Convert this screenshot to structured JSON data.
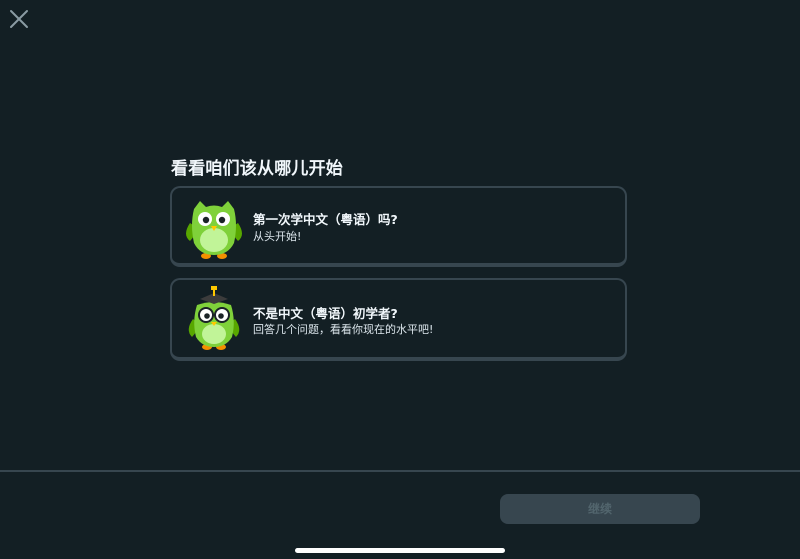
{
  "header": {
    "close_icon": "close-icon"
  },
  "main": {
    "title": "看看咱们该从哪儿开始",
    "options": [
      {
        "icon": "owl-mascot-icon",
        "title": "第一次学中文（粤语）吗?",
        "subtitle": "从头开始!"
      },
      {
        "icon": "owl-graduate-mascot-icon",
        "title": "不是中文（粤语）初学者?",
        "subtitle": "回答几个问题，看看你现在的水平吧!"
      }
    ]
  },
  "footer": {
    "continue_label": "继续",
    "continue_state": "disabled"
  },
  "colors": {
    "background": "#131f24",
    "card_border": "#37464f",
    "button_disabled_bg": "#37464f",
    "button_disabled_text": "#52656d",
    "owl_green": "#7fd13a"
  }
}
